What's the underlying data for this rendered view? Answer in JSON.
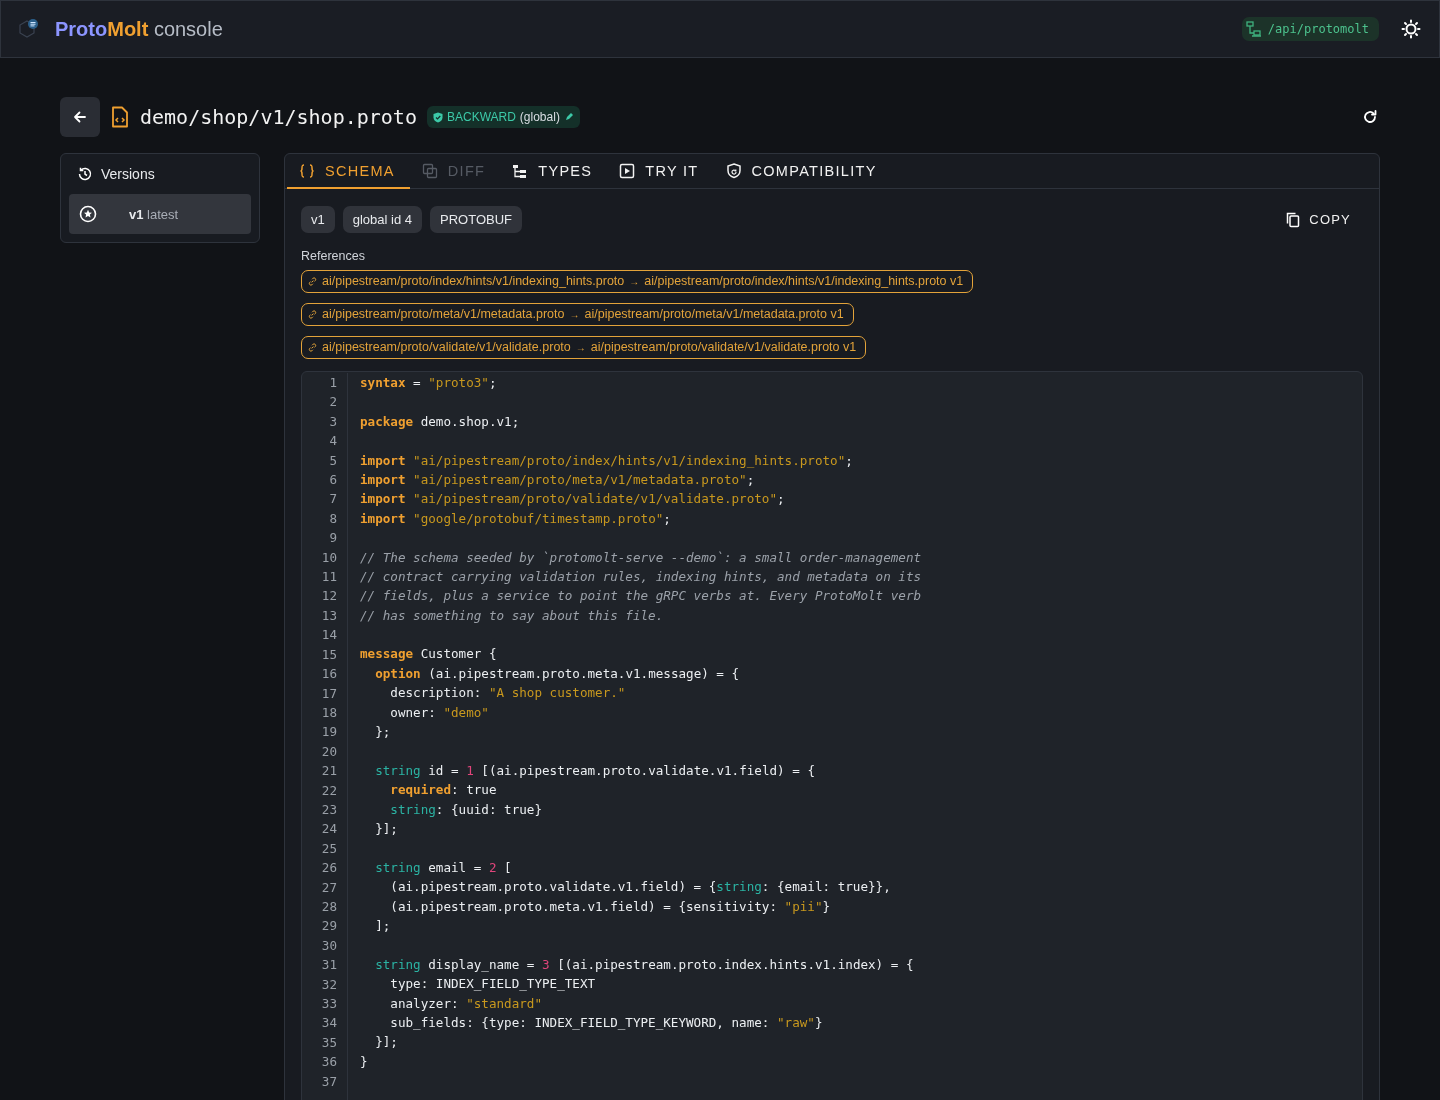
{
  "header": {
    "brand_first": "Proto",
    "brand_second": "Molt",
    "brand_suffix": "console",
    "api_badge": "/api/protomolt"
  },
  "title_bar": {
    "path": "demo/shop/v1/shop.proto",
    "compat_badge": "BACKWARD",
    "compat_scope": "(global)"
  },
  "sidebar": {
    "heading": "Versions",
    "items": [
      {
        "version": "v1",
        "tag": "latest",
        "selected": true
      }
    ]
  },
  "tabs": [
    {
      "label": "SCHEMA",
      "selected": true,
      "disabled": false
    },
    {
      "label": "DIFF",
      "selected": false,
      "disabled": true
    },
    {
      "label": "TYPES",
      "selected": false,
      "disabled": false
    },
    {
      "label": "TRY IT",
      "selected": false,
      "disabled": false
    },
    {
      "label": "COMPATIBILITY",
      "selected": false,
      "disabled": false
    }
  ],
  "chips": [
    "v1",
    "global id 4",
    "PROTOBUF"
  ],
  "copy_button": "COPY",
  "references_label": "References",
  "references": [
    {
      "from": "ai/pipestream/proto/index/hints/v1/indexing_hints.proto",
      "arrow": "→",
      "to": "ai/pipestream/proto/index/hints/v1/indexing_hints.proto v1"
    },
    {
      "from": "ai/pipestream/proto/meta/v1/metadata.proto",
      "arrow": "→",
      "to": "ai/pipestream/proto/meta/v1/metadata.proto v1"
    },
    {
      "from": "ai/pipestream/proto/validate/v1/validate.proto",
      "arrow": "→",
      "to": "ai/pipestream/proto/validate/v1/validate.proto v1"
    }
  ],
  "code_lines": [
    {
      "number": "1",
      "tokens": [
        {
          "kind": "keyword",
          "text": "syntax"
        },
        {
          "kind": "plain",
          "text": " = "
        },
        {
          "kind": "string",
          "text": "\"proto3\""
        },
        {
          "kind": "plain",
          "text": ";"
        }
      ]
    },
    {
      "number": "2"
    },
    {
      "number": "3",
      "tokens": [
        {
          "kind": "keyword",
          "text": "package"
        },
        {
          "kind": "plain",
          "text": " demo.shop.v1;"
        }
      ]
    },
    {
      "number": "4"
    },
    {
      "number": "5",
      "tokens": [
        {
          "kind": "keyword",
          "text": "import"
        },
        {
          "kind": "string",
          "text": " \"ai/pipestream/proto/index/hints/v1/indexing_hints.proto\""
        },
        {
          "kind": "plain",
          "text": ";"
        }
      ]
    },
    {
      "number": "6",
      "tokens": [
        {
          "kind": "keyword",
          "text": "import"
        },
        {
          "kind": "string",
          "text": " \"ai/pipestream/proto/meta/v1/metadata.proto\""
        },
        {
          "kind": "plain",
          "text": ";"
        }
      ]
    },
    {
      "number": "7",
      "tokens": [
        {
          "kind": "keyword",
          "text": "import"
        },
        {
          "kind": "string",
          "text": " \"ai/pipestream/proto/validate/v1/validate.proto\""
        },
        {
          "kind": "plain",
          "text": ";"
        }
      ]
    },
    {
      "number": "8",
      "tokens": [
        {
          "kind": "keyword",
          "text": "import"
        },
        {
          "kind": "string",
          "text": " \"google/protobuf/timestamp.proto\""
        },
        {
          "kind": "plain",
          "text": ";"
        }
      ]
    },
    {
      "number": "9"
    },
    {
      "number": "10",
      "tokens": [
        {
          "kind": "comment",
          "text": "// The schema seeded by `protomolt-serve --demo`: a small order-management"
        }
      ]
    },
    {
      "number": "11",
      "tokens": [
        {
          "kind": "comment",
          "text": "// contract carrying validation rules, indexing hints, and metadata on its"
        }
      ]
    },
    {
      "number": "12",
      "tokens": [
        {
          "kind": "comment",
          "text": "// fields, plus a service to point the gRPC verbs at. Every ProtoMolt verb"
        }
      ]
    },
    {
      "number": "13",
      "tokens": [
        {
          "kind": "comment",
          "text": "// has something to say about this file."
        }
      ]
    },
    {
      "number": "14"
    },
    {
      "number": "15",
      "tokens": [
        {
          "kind": "keyword",
          "text": "message"
        },
        {
          "kind": "plain",
          "text": " Customer {"
        }
      ]
    },
    {
      "number": "16",
      "tokens": [
        {
          "kind": "keyword",
          "text": "  option"
        },
        {
          "kind": "plain",
          "text": " (ai.pipestream.proto.meta.v1.message) = {"
        }
      ]
    },
    {
      "number": "17",
      "tokens": [
        {
          "kind": "plain",
          "text": "    description: "
        },
        {
          "kind": "string",
          "text": "\"A shop customer.\""
        }
      ]
    },
    {
      "number": "18",
      "tokens": [
        {
          "kind": "plain",
          "text": "    owner: "
        },
        {
          "kind": "string",
          "text": "\"demo\""
        }
      ]
    },
    {
      "number": "19",
      "tokens": [
        {
          "kind": "plain",
          "text": "  };"
        }
      ]
    },
    {
      "number": "20"
    },
    {
      "number": "21",
      "tokens": [
        {
          "kind": "type",
          "text": "  string"
        },
        {
          "kind": "plain",
          "text": " id = "
        },
        {
          "kind": "number",
          "text": "1"
        },
        {
          "kind": "plain",
          "text": " [(ai.pipestream.proto.validate.v1.field) = {"
        }
      ]
    },
    {
      "number": "22",
      "tokens": [
        {
          "kind": "keyword",
          "text": "    required"
        },
        {
          "kind": "plain",
          "text": ": true"
        }
      ]
    },
    {
      "number": "23",
      "tokens": [
        {
          "kind": "type",
          "text": "    string"
        },
        {
          "kind": "plain",
          "text": ": {uuid: true}"
        }
      ]
    },
    {
      "number": "24",
      "tokens": [
        {
          "kind": "plain",
          "text": "  }];"
        }
      ]
    },
    {
      "number": "25"
    },
    {
      "number": "26",
      "tokens": [
        {
          "kind": "type",
          "text": "  string"
        },
        {
          "kind": "plain",
          "text": " email = "
        },
        {
          "kind": "number",
          "text": "2"
        },
        {
          "kind": "plain",
          "text": " ["
        }
      ]
    },
    {
      "number": "27",
      "tokens": [
        {
          "kind": "plain",
          "text": "    (ai.pipestream.proto.validate.v1.field) = {"
        },
        {
          "kind": "type",
          "text": "string"
        },
        {
          "kind": "plain",
          "text": ": {email: true}},"
        }
      ]
    },
    {
      "number": "28",
      "tokens": [
        {
          "kind": "plain",
          "text": "    (ai.pipestream.proto.meta.v1.field) = {sensitivity: "
        },
        {
          "kind": "string",
          "text": "\"pii\""
        },
        {
          "kind": "plain",
          "text": "}"
        }
      ]
    },
    {
      "number": "29",
      "tokens": [
        {
          "kind": "plain",
          "text": "  ];"
        }
      ]
    },
    {
      "number": "30"
    },
    {
      "number": "31",
      "tokens": [
        {
          "kind": "type",
          "text": "  string"
        },
        {
          "kind": "plain",
          "text": " display_name = "
        },
        {
          "kind": "number",
          "text": "3"
        },
        {
          "kind": "plain",
          "text": " [(ai.pipestream.proto.index.hints.v1.index) = {"
        }
      ]
    },
    {
      "number": "32",
      "tokens": [
        {
          "kind": "plain",
          "text": "    type: INDEX_FIELD_TYPE_TEXT"
        }
      ]
    },
    {
      "number": "33",
      "tokens": [
        {
          "kind": "plain",
          "text": "    analyzer: "
        },
        {
          "kind": "string",
          "text": "\"standard\""
        }
      ]
    },
    {
      "number": "34",
      "tokens": [
        {
          "kind": "plain",
          "text": "    sub_fields: {type: INDEX_FIELD_TYPE_KEYWORD, name: "
        },
        {
          "kind": "string",
          "text": "\"raw\""
        },
        {
          "kind": "plain",
          "text": "}"
        }
      ]
    },
    {
      "number": "35",
      "tokens": [
        {
          "kind": "plain",
          "text": "  }];"
        }
      ]
    },
    {
      "number": "36",
      "tokens": [
        {
          "kind": "plain",
          "text": "}"
        }
      ]
    },
    {
      "number": "37"
    }
  ]
}
